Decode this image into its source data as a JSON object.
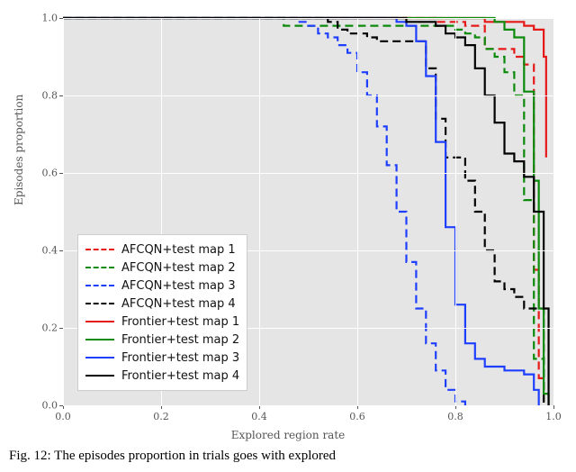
{
  "chart_data": {
    "type": "line",
    "xlabel": "Explored region rate",
    "ylabel": "Episodes proportion",
    "xlim": [
      0.0,
      1.0
    ],
    "ylim": [
      0.0,
      1.0
    ],
    "xticks": [
      0.0,
      0.2,
      0.4,
      0.6,
      0.8,
      1.0
    ],
    "yticks": [
      0.0,
      0.2,
      0.4,
      0.6,
      0.8,
      1.0
    ],
    "xtick_labels": [
      "0.0",
      "0.2",
      "0.4",
      "0.6",
      "0.8",
      "1.0"
    ],
    "ytick_labels": [
      "0.0",
      "0.2",
      "0.4",
      "0.6",
      "0.8",
      "1.0"
    ],
    "legend_position": "lower-left",
    "series": [
      {
        "name": "AFCQN+test map 1",
        "style": "dashed",
        "color": "#e61919",
        "x": [
          0.0,
          0.74,
          0.76,
          0.78,
          0.8,
          0.82,
          0.84,
          0.86,
          0.88,
          0.9,
          0.92,
          0.94,
          0.96,
          0.97,
          0.98
        ],
        "y": [
          1.0,
          1.0,
          0.99,
          0.99,
          0.99,
          0.98,
          0.98,
          0.92,
          0.92,
          0.92,
          0.9,
          0.88,
          0.35,
          0.07,
          0.0
        ]
      },
      {
        "name": "AFCQN+test map 2",
        "style": "dashed",
        "color": "#0c8a0c",
        "x": [
          0.0,
          0.4,
          0.45,
          0.5,
          0.55,
          0.6,
          0.7,
          0.78,
          0.8,
          0.82,
          0.84,
          0.86,
          0.88,
          0.9,
          0.92,
          0.94,
          0.96,
          0.98
        ],
        "y": [
          1.0,
          1.0,
          0.98,
          0.98,
          0.98,
          0.98,
          0.98,
          0.98,
          0.97,
          0.96,
          0.95,
          0.92,
          0.9,
          0.86,
          0.8,
          0.53,
          0.12,
          0.0
        ]
      },
      {
        "name": "AFCQN+test map 3",
        "style": "dashed",
        "color": "#1f3fff",
        "x": [
          0.0,
          0.46,
          0.48,
          0.5,
          0.52,
          0.54,
          0.56,
          0.58,
          0.6,
          0.62,
          0.64,
          0.66,
          0.68,
          0.7,
          0.72,
          0.74,
          0.76,
          0.78,
          0.8,
          0.82
        ],
        "y": [
          1.0,
          1.0,
          0.99,
          0.98,
          0.96,
          0.95,
          0.93,
          0.91,
          0.86,
          0.8,
          0.72,
          0.62,
          0.5,
          0.37,
          0.25,
          0.16,
          0.09,
          0.04,
          0.01,
          0.0
        ]
      },
      {
        "name": "AFCQN+test map 4",
        "style": "dashed",
        "color": "#000000",
        "x": [
          0.0,
          0.5,
          0.54,
          0.56,
          0.58,
          0.6,
          0.62,
          0.64,
          0.68,
          0.72,
          0.74,
          0.76,
          0.78,
          0.8,
          0.82,
          0.84,
          0.86,
          0.88,
          0.9,
          0.92,
          0.94,
          0.96,
          0.98
        ],
        "y": [
          1.0,
          1.0,
          0.99,
          0.97,
          0.96,
          0.96,
          0.95,
          0.94,
          0.94,
          0.94,
          0.87,
          0.74,
          0.64,
          0.64,
          0.58,
          0.5,
          0.4,
          0.32,
          0.3,
          0.28,
          0.25,
          0.25,
          0.0
        ]
      },
      {
        "name": "Frontier+test map 1",
        "style": "solid",
        "color": "#e61919",
        "x": [
          0.0,
          0.85,
          0.86,
          0.88,
          0.9,
          0.92,
          0.94,
          0.96,
          0.98,
          0.985
        ],
        "y": [
          1.0,
          1.0,
          0.99,
          0.99,
          0.99,
          0.99,
          0.98,
          0.97,
          0.9,
          0.64
        ]
      },
      {
        "name": "Frontier+test map 2",
        "style": "solid",
        "color": "#0c8a0c",
        "x": [
          0.0,
          0.85,
          0.86,
          0.88,
          0.9,
          0.92,
          0.94,
          0.96,
          0.97,
          0.98,
          0.99
        ],
        "y": [
          1.0,
          1.0,
          1.0,
          0.99,
          0.97,
          0.95,
          0.81,
          0.58,
          0.25,
          0.03,
          0.0
        ]
      },
      {
        "name": "Frontier+test map 3",
        "style": "solid",
        "color": "#1f3fff",
        "x": [
          0.0,
          0.65,
          0.68,
          0.7,
          0.72,
          0.74,
          0.76,
          0.78,
          0.8,
          0.82,
          0.84,
          0.86,
          0.9,
          0.94,
          0.96,
          0.97
        ],
        "y": [
          1.0,
          1.0,
          0.99,
          0.98,
          0.94,
          0.85,
          0.68,
          0.46,
          0.26,
          0.16,
          0.12,
          0.1,
          0.09,
          0.08,
          0.04,
          0.0
        ]
      },
      {
        "name": "Frontier+test map 4",
        "style": "solid",
        "color": "#000000",
        "x": [
          0.0,
          0.66,
          0.7,
          0.74,
          0.76,
          0.78,
          0.8,
          0.82,
          0.84,
          0.86,
          0.88,
          0.9,
          0.92,
          0.94,
          0.96,
          0.98,
          0.99
        ],
        "y": [
          1.0,
          1.0,
          0.99,
          0.99,
          0.98,
          0.96,
          0.95,
          0.93,
          0.87,
          0.8,
          0.73,
          0.65,
          0.63,
          0.59,
          0.5,
          0.25,
          0.0
        ]
      }
    ]
  },
  "caption": "Fig. 12: The episodes proportion in trials goes with explored"
}
